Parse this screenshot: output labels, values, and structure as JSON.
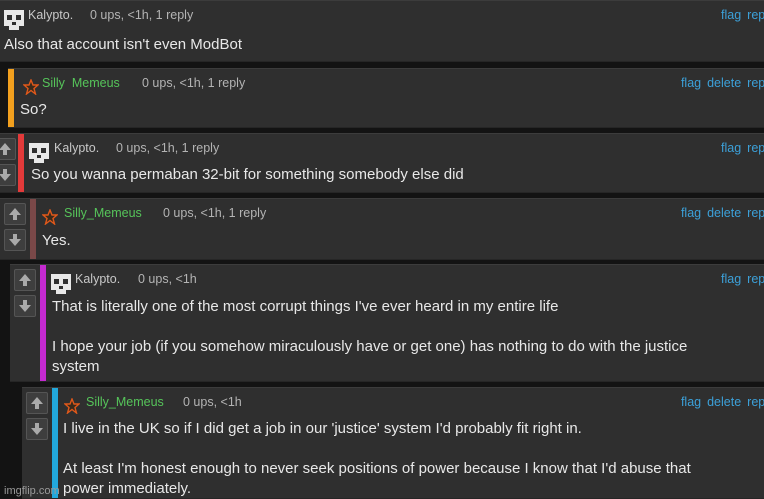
{
  "comments": [
    {
      "user": "Kalypto.",
      "meta": "0 ups, <1h, 1 reply",
      "body": [
        "Also that account isn't even ModBot"
      ],
      "actions": [
        "flag",
        "repl"
      ],
      "bar_color": "",
      "user_color": "#c8c8c8"
    },
    {
      "user": "Silly  Memeus",
      "meta": "0 ups, <1h, 1 reply",
      "body": [
        "So?"
      ],
      "actions": [
        "flag",
        "delete",
        "repl"
      ],
      "bar_color": "#f2a01e",
      "user_color": "#56c45a"
    },
    {
      "user": "Kalypto.",
      "meta": "0 ups, <1h, 1 reply",
      "body": [
        "So you wanna permaban 32-bit for something somebody else did"
      ],
      "actions": [
        "flag",
        "repl"
      ],
      "bar_color": "#e33a3a",
      "user_color": "#c8c8c8"
    },
    {
      "user": "Silly_Memeus",
      "meta": "0 ups, <1h, 1 reply",
      "body": [
        "Yes."
      ],
      "actions": [
        "flag",
        "delete",
        "repl"
      ],
      "bar_color": "#7a4848",
      "user_color": "#56c45a"
    },
    {
      "user": "Kalypto.",
      "meta": "0 ups, <1h",
      "body": [
        "That is literally one of the most corrupt things I've ever heard in my entire life",
        "",
        "I hope your job (if you somehow miraculously have or get one) has nothing to do with the justice",
        "system"
      ],
      "actions": [
        "flag",
        "repl"
      ],
      "bar_color": "#c42ad0",
      "user_color": "#c8c8c8"
    },
    {
      "user": "Silly_Memeus",
      "meta": "0 ups, <1h",
      "body": [
        "I live in the UK so if I did get a job in our 'justice' system I'd probably fit right in.",
        "",
        "At least I'm honest enough to never seek positions of power because I know that I'd abuse that",
        "power immediately."
      ],
      "actions": [
        "flag",
        "delete",
        "repl"
      ],
      "bar_color": "#22a8dc",
      "user_color": "#56c45a"
    }
  ],
  "watermark": "imgflip.com",
  "icons": {
    "avatar": "skull-avatar-icon",
    "star": "star-avatar-icon",
    "up": "upvote-arrow-icon",
    "down": "downvote-arrow-icon"
  }
}
